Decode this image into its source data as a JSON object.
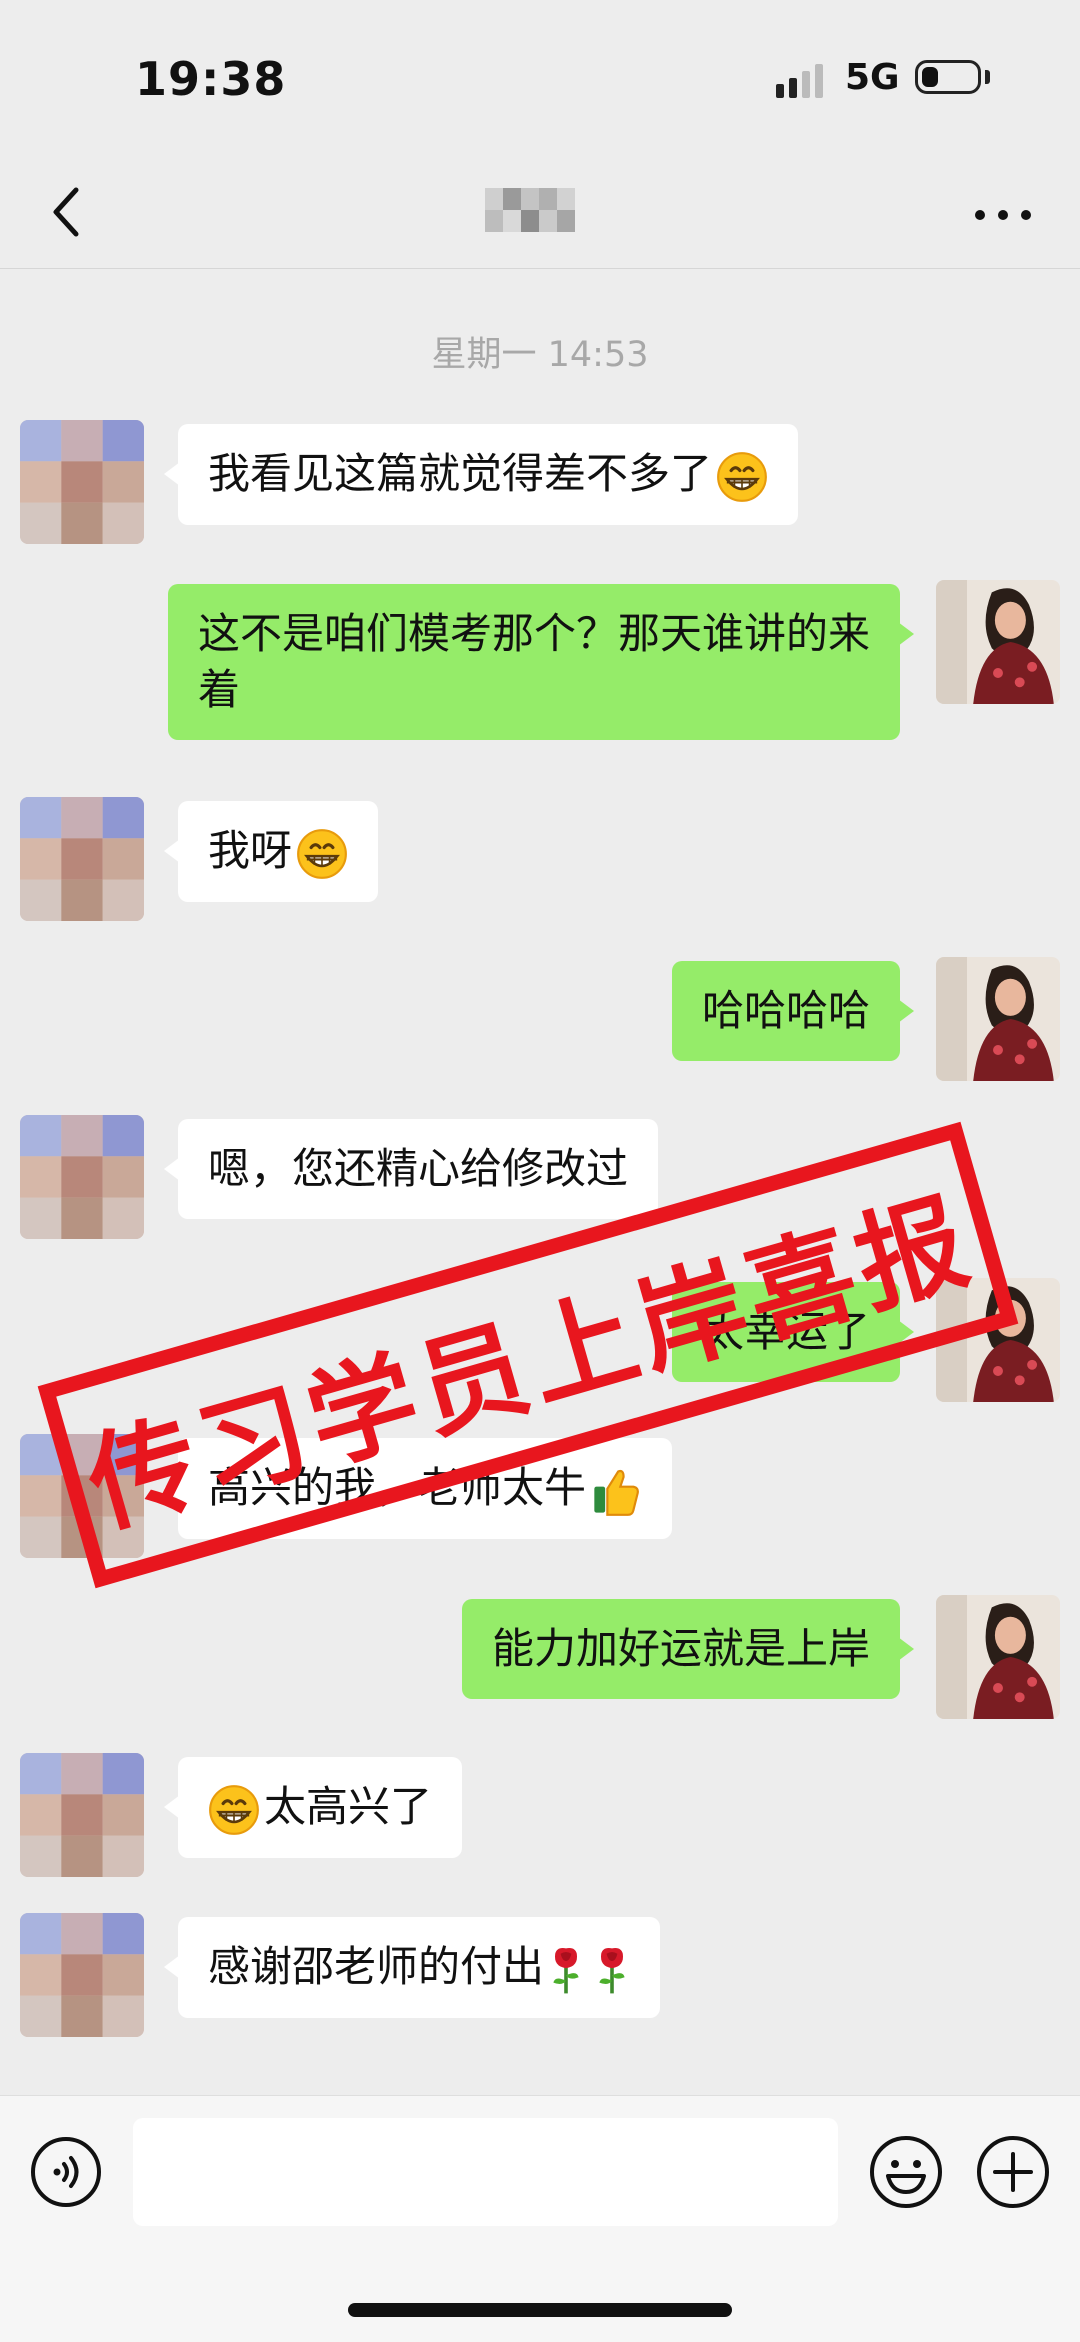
{
  "status_bar": {
    "time": "19:38",
    "network": "5G",
    "battery_percent": 30
  },
  "nav": {
    "title": ""
  },
  "timestamp": "星期一 14:53",
  "messages": [
    {
      "from": "other",
      "text": "我看见这篇就觉得差不多了",
      "emoji": "grinning-face-icon"
    },
    {
      "from": "me",
      "text": "这不是咱们模考那个？那天谁讲的来着"
    },
    {
      "from": "other",
      "text": "我呀",
      "emoji": "grinning-face-icon"
    },
    {
      "from": "me",
      "text": "哈哈哈哈"
    },
    {
      "from": "other",
      "text": "嗯，您还精心给修改过"
    },
    {
      "from": "me",
      "text": "太幸运了"
    },
    {
      "from": "other",
      "text": "高兴的我，老师太牛",
      "emoji": "thumbs-up-icon"
    },
    {
      "from": "me",
      "text": "能力加好运就是上岸"
    },
    {
      "from": "other",
      "text": "太高兴了",
      "emoji_before": "grinning-face-icon"
    },
    {
      "from": "other",
      "text": "感谢邵老师的付出",
      "emoji": "rose-icon"
    }
  ],
  "stamp": {
    "text": "传习学员上岸喜报",
    "color": "#e8161e"
  },
  "colors": {
    "background": "#ededed",
    "incoming_bubble": "#ffffff",
    "outgoing_bubble": "#95ec69"
  },
  "input": {
    "value": "",
    "placeholder": ""
  }
}
